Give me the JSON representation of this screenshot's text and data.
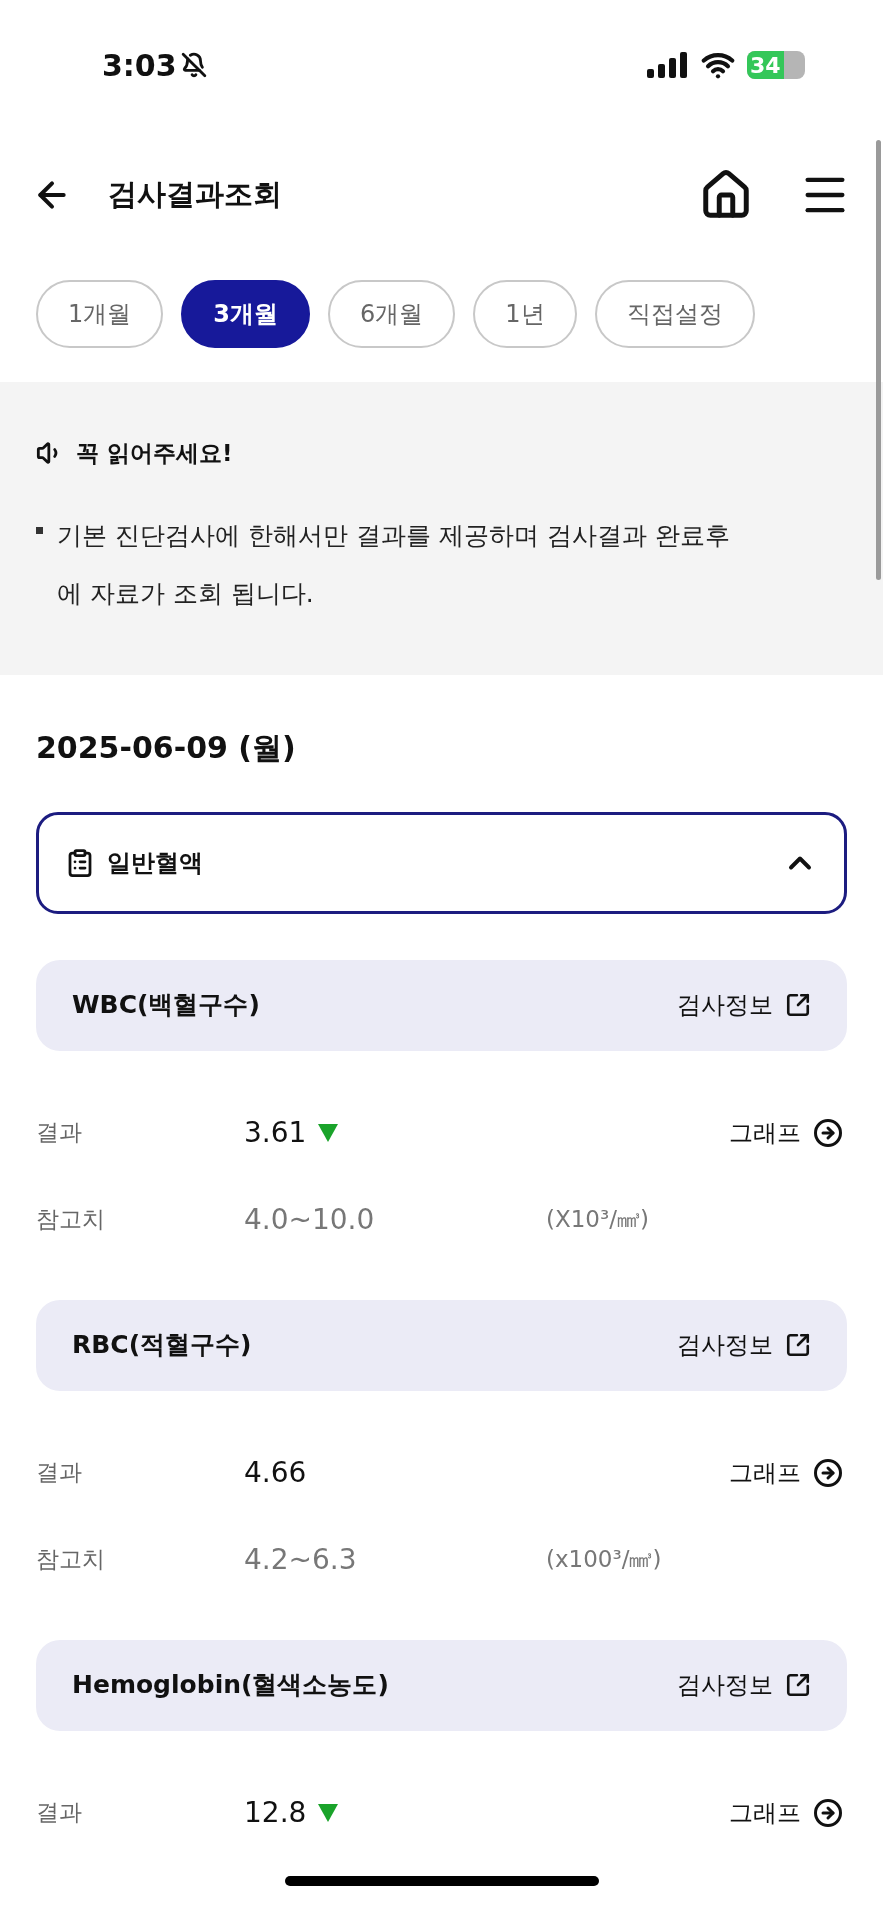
{
  "status_bar": {
    "time": "3:03",
    "battery": "34"
  },
  "header": {
    "title": "검사결과조회"
  },
  "period_tabs": [
    {
      "label": "1개월",
      "selected": false
    },
    {
      "label": "3개월",
      "selected": true
    },
    {
      "label": "6개월",
      "selected": false
    },
    {
      "label": "1년",
      "selected": false
    },
    {
      "label": "직접설정",
      "selected": false
    }
  ],
  "notice": {
    "title": "꼭 읽어주세요!",
    "items": [
      "기본 진단검사에 한해서만 결과를 제공하며 검사결과 완료후에 자료가 조회 됩니다."
    ]
  },
  "date": "2025-06-09 (월)",
  "category": {
    "label": "일반혈액",
    "expanded": true
  },
  "tests": [
    {
      "name": "WBC(백혈구수)",
      "info_link": "검사정보",
      "result_label": "결과",
      "result": "3.61",
      "below_range": true,
      "graph_link": "그래프",
      "reference_label": "참고치",
      "reference": "4.0~10.0",
      "unit": "(X10³/㎣)"
    },
    {
      "name": "RBC(적혈구수)",
      "info_link": "검사정보",
      "result_label": "결과",
      "result": "4.66",
      "below_range": false,
      "graph_link": "그래프",
      "reference_label": "참고치",
      "reference": "4.2~6.3",
      "unit": "(x100³/㎣)"
    },
    {
      "name": "Hemoglobin(혈색소농도)",
      "info_link": "검사정보",
      "result_label": "결과",
      "result": "12.8",
      "below_range": true,
      "graph_link": "그래프"
    }
  ]
}
